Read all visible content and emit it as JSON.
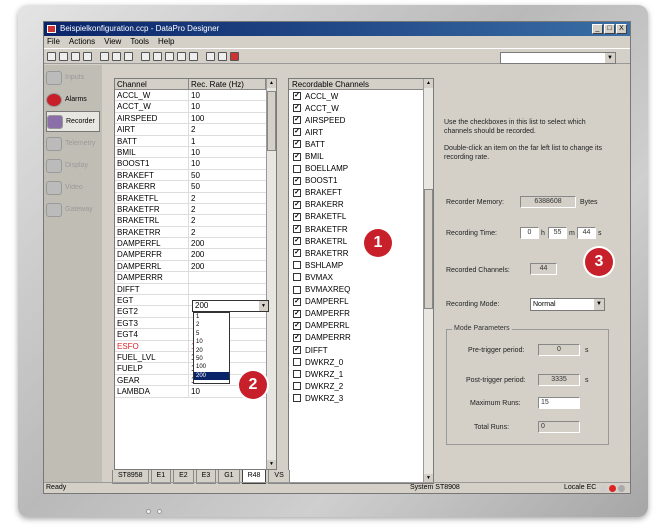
{
  "window": {
    "title": "Beispielkonfiguration.ccp - DataPro Designer",
    "min": "_",
    "max": "□",
    "close": "X"
  },
  "menu": [
    "File",
    "Actions",
    "View",
    "Tools",
    "Help"
  ],
  "sidebar": [
    {
      "label": "Inputs",
      "state": "disabled",
      "icon": "inputs-icon"
    },
    {
      "label": "Alarms",
      "state": "active",
      "icon": "alarms-icon"
    },
    {
      "label": "Recorder",
      "state": "selected",
      "icon": "recorder-icon"
    },
    {
      "label": "Telemetry",
      "state": "disabled",
      "icon": "telemetry-icon"
    },
    {
      "label": "Display",
      "state": "disabled",
      "icon": "display-icon"
    },
    {
      "label": "Video",
      "state": "disabled",
      "icon": "video-icon"
    },
    {
      "label": "Gateway",
      "state": "disabled",
      "icon": "gateway-icon"
    }
  ],
  "rate_table": {
    "col_channel": "Channel",
    "col_rate": "Rec. Rate (Hz)",
    "rows": [
      [
        "ACCL_W",
        "10"
      ],
      [
        "ACCT_W",
        "10"
      ],
      [
        "AIRSPEED",
        "100"
      ],
      [
        "AIRT",
        "2"
      ],
      [
        "BATT",
        "1"
      ],
      [
        "BMIL",
        "10"
      ],
      [
        "BOOST1",
        "10"
      ],
      [
        "BRAKEFT",
        "50"
      ],
      [
        "BRAKERR",
        "50"
      ],
      [
        "BRAKETFL",
        "2"
      ],
      [
        "BRAKETFR",
        "2"
      ],
      [
        "BRAKETRL",
        "2"
      ],
      [
        "BRAKETRR",
        "2"
      ],
      [
        "DAMPERFL",
        "200"
      ],
      [
        "DAMPERFR",
        "200"
      ],
      [
        "DAMPERRL",
        "200"
      ],
      [
        "DAMPERRR",
        ""
      ],
      [
        "DIFFT",
        ""
      ],
      [
        "EGT",
        ""
      ],
      [
        "EGT2",
        ""
      ],
      [
        "EGT3",
        ""
      ],
      [
        "EGT4",
        ""
      ],
      [
        "ESFO",
        "10"
      ],
      [
        "FUEL_LVL",
        "1"
      ],
      [
        "FUELP",
        "10"
      ],
      [
        "GEAR",
        "10"
      ],
      [
        "LAMBDA",
        "10"
      ]
    ],
    "red_row": "ESFO",
    "dropdown_value": "200",
    "dropdown_options": [
      "1",
      "2",
      "5",
      "10",
      "20",
      "50",
      "100",
      "200"
    ],
    "dropdown_selected": "200"
  },
  "channels": {
    "header": "Recordable Channels",
    "items": [
      [
        "ACCL_W",
        true
      ],
      [
        "ACCT_W",
        true
      ],
      [
        "AIRSPEED",
        true
      ],
      [
        "AIRT",
        true
      ],
      [
        "BATT",
        true
      ],
      [
        "BMIL",
        true
      ],
      [
        "BOELLAMP",
        false
      ],
      [
        "BOOST1",
        true
      ],
      [
        "BRAKEFT",
        true
      ],
      [
        "BRAKERR",
        true
      ],
      [
        "BRAKETFL",
        true
      ],
      [
        "BRAKETFR",
        true
      ],
      [
        "BRAKETRL",
        true
      ],
      [
        "BRAKETRR",
        true
      ],
      [
        "BSHLAMP",
        false
      ],
      [
        "BVMAX",
        false
      ],
      [
        "BVMAXREQ",
        false
      ],
      [
        "DAMPERFL",
        true
      ],
      [
        "DAMPERFR",
        true
      ],
      [
        "DAMPERRL",
        true
      ],
      [
        "DAMPERRR",
        true
      ],
      [
        "DIFFT",
        true
      ],
      [
        "DWKRZ_0",
        false
      ],
      [
        "DWKRZ_1",
        false
      ],
      [
        "DWKRZ_2",
        false
      ],
      [
        "DWKRZ_3",
        false
      ]
    ]
  },
  "info": {
    "line1": "Use the checkboxes in this list to select which channels should be recorded.",
    "line2": "Double-click an item on the far left list to change its recording rate."
  },
  "fields": {
    "memory_label": "Recorder Memory:",
    "memory_value": "6388608",
    "memory_unit": "Bytes",
    "time_label": "Recording Time:",
    "time_h": "0",
    "time_h_unit": "h",
    "time_m": "55",
    "time_m_unit": "m",
    "time_s": "44",
    "time_s_unit": "s",
    "channels_label": "Recorded Channels:",
    "channels_value": "44",
    "mode_label": "Recording Mode:",
    "mode_value": "Normal",
    "group_title": "Mode Parameters",
    "pre_label": "Pre-trigger period:",
    "pre_value": "0",
    "pre_unit": "s",
    "post_label": "Post-trigger period:",
    "post_value": "3335",
    "post_unit": "s",
    "maxruns_label": "Maximum Runs:",
    "maxruns_value": "15",
    "total_label": "Total Runs:",
    "total_value": "0"
  },
  "tabs": [
    "ST8958",
    "E1",
    "E2",
    "E3",
    "G1",
    "R48",
    "VS"
  ],
  "active_tab": "R48",
  "status": {
    "left": "Ready",
    "system": "System ST8908",
    "locale": "Locale EC"
  },
  "badges": [
    "1",
    "2",
    "3"
  ]
}
